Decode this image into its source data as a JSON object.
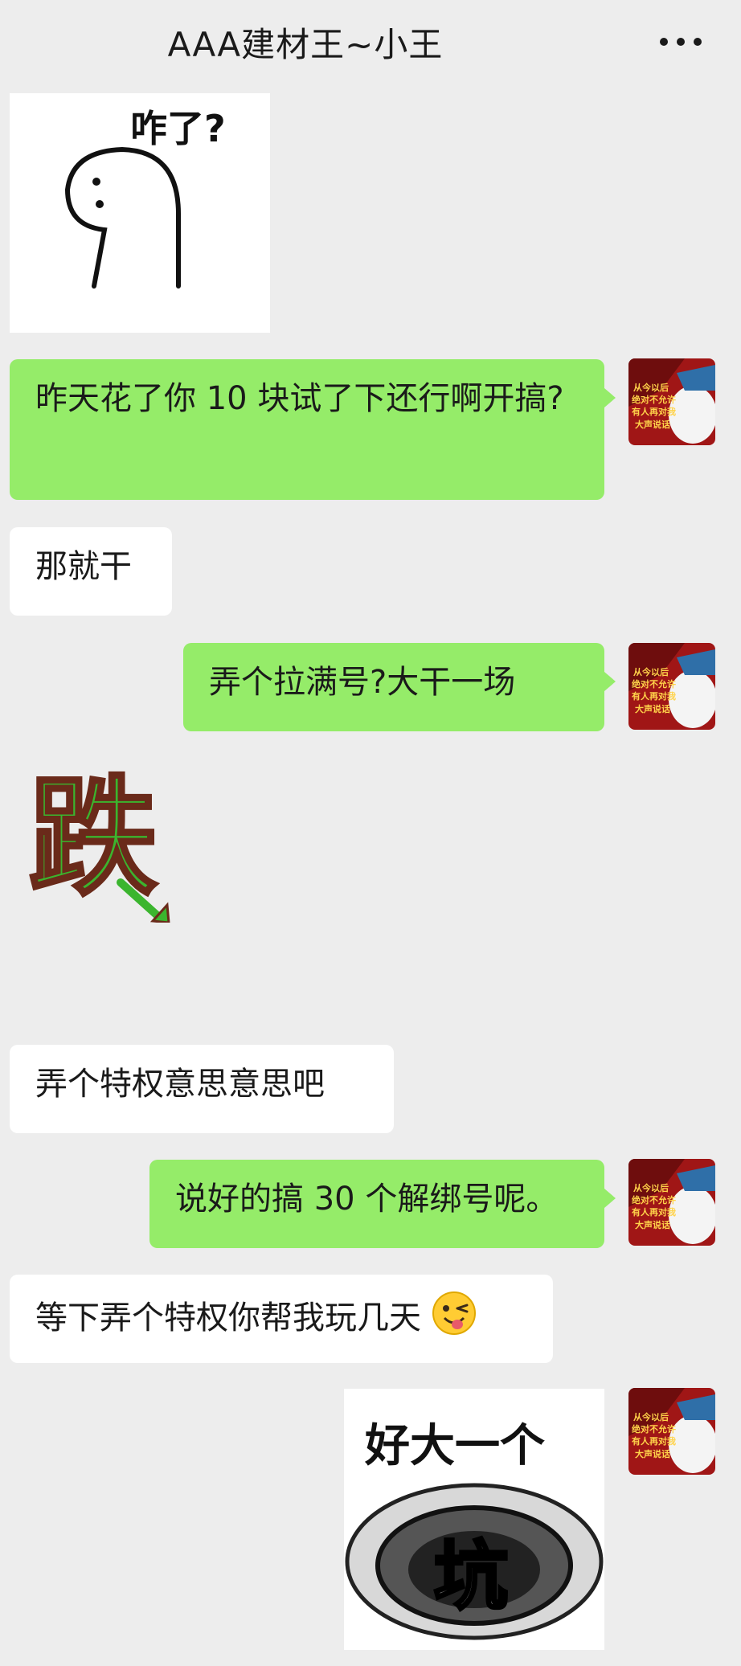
{
  "header": {
    "title": "AAA建材王~小王",
    "more_icon": "more-dots-icon"
  },
  "stickers": {
    "zale": {
      "text": "咋了?"
    },
    "die": {
      "text": "跌"
    },
    "hole": {
      "line1": "好大一个",
      "line2": "坑"
    }
  },
  "avatar": {
    "line1": "从今以后",
    "line2": "绝对不允许",
    "line3": "有人再对我",
    "line4": "大声说话"
  },
  "messages": [
    {
      "side": "sent",
      "text": "昨天花了你 10 块试了下还行啊开搞?"
    },
    {
      "side": "received",
      "text": "那就干"
    },
    {
      "side": "sent",
      "text": "弄个拉满号?大干一场"
    },
    {
      "side": "received",
      "text": "弄个特权意思意思吧"
    },
    {
      "side": "sent",
      "text": "说好的搞 30 个解绑号呢。"
    },
    {
      "side": "received",
      "text": "等下弄个特权你帮我玩几天",
      "emoji": "winking-tongue-emoji"
    }
  ],
  "colors": {
    "sent_bubble": "#95ec69",
    "received_bubble": "#ffffff",
    "background": "#ededed"
  }
}
